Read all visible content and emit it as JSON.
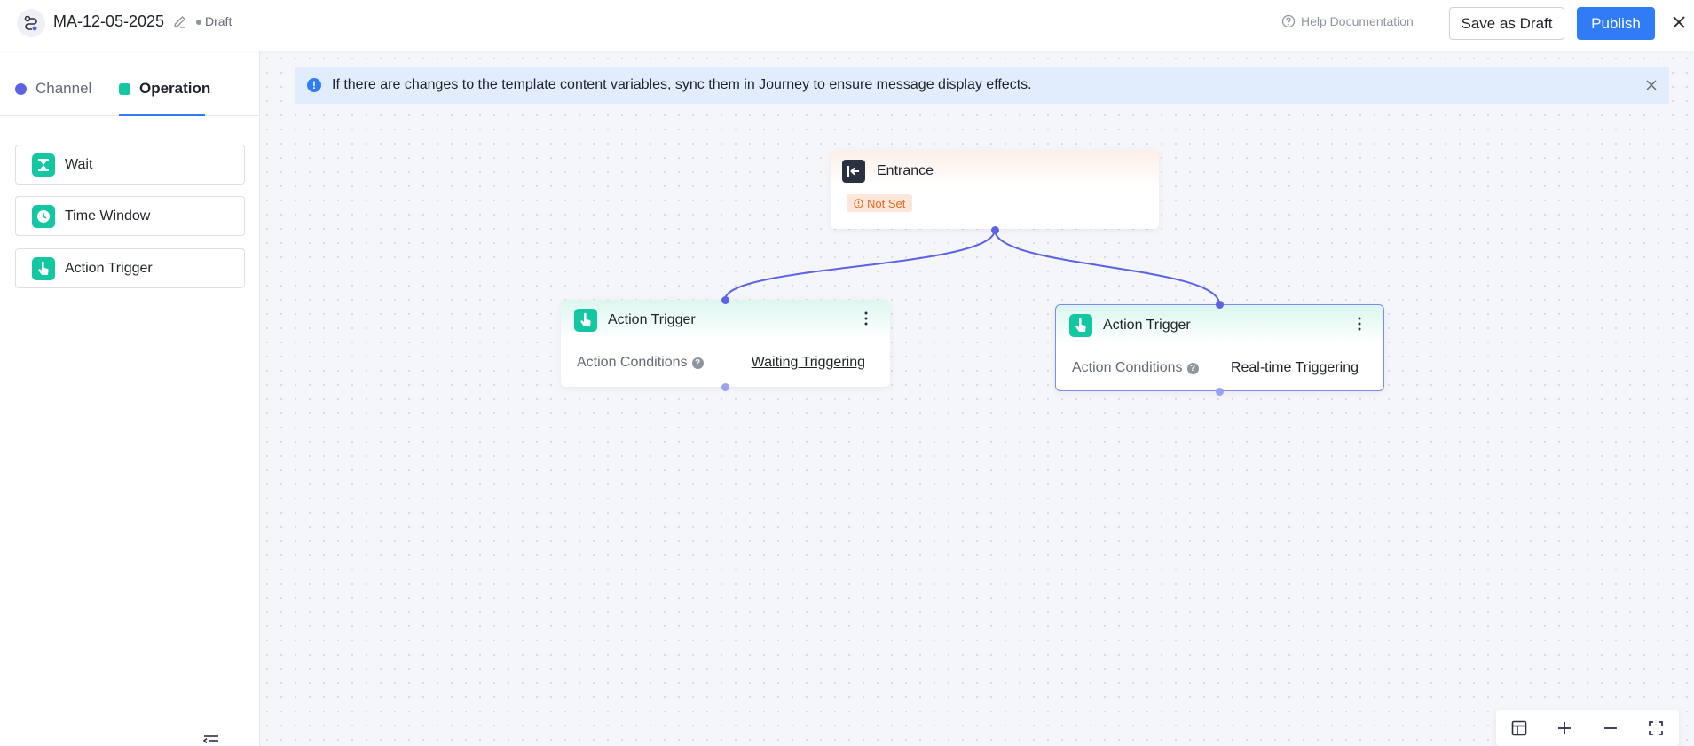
{
  "header": {
    "title": "MA-12-05-2025",
    "status": "Draft",
    "help_label": "Help Documentation",
    "save_draft_label": "Save as Draft",
    "publish_label": "Publish"
  },
  "sidebar": {
    "tabs": [
      {
        "label": "Channel",
        "active": false
      },
      {
        "label": "Operation",
        "active": true
      }
    ],
    "items": [
      {
        "label": "Wait",
        "icon": "hourglass-icon"
      },
      {
        "label": "Time Window",
        "icon": "clock-icon"
      },
      {
        "label": "Action Trigger",
        "icon": "hand-pointer-icon"
      }
    ]
  },
  "banner": {
    "text": "If there are changes to the template content variables, sync them in Journey to ensure message display effects."
  },
  "nodes": {
    "entrance": {
      "title": "Entrance",
      "badge": "Not Set"
    },
    "trigger_1": {
      "title": "Action Trigger",
      "condition_label": "Action Conditions",
      "condition_value": "Waiting Triggering"
    },
    "trigger_2": {
      "title": "Action Trigger",
      "condition_label": "Action Conditions",
      "condition_value": "Real-time Triggering"
    }
  },
  "colors": {
    "primary": "#2f7cf6",
    "channel": "#5b62e6",
    "operation": "#12c7a1",
    "edge": "#5b62e6",
    "warning": "#e46a1e"
  }
}
